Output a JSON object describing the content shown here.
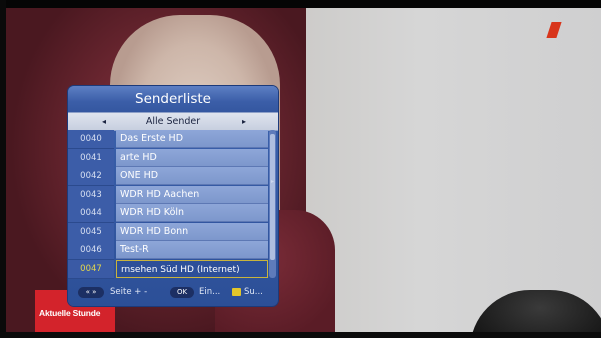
{
  "osd": {
    "title": "Senderliste",
    "filter": {
      "label": "Alle Sender",
      "left_arrow": "◂",
      "right_arrow": "▸"
    },
    "channels": [
      {
        "number": "0040",
        "name": "Das Erste HD"
      },
      {
        "number": "0041",
        "name": "arte HD"
      },
      {
        "number": "0042",
        "name": "ONE HD"
      },
      {
        "number": "0043",
        "name": "WDR HD Aachen"
      },
      {
        "number": "0044",
        "name": "WDR HD Köln"
      },
      {
        "number": "0045",
        "name": "WDR HD Bonn"
      },
      {
        "number": "0046",
        "name": "Test-R"
      },
      {
        "number": "0047",
        "name": "rnsehen Süd HD (Internet)"
      }
    ],
    "selected_channel": "0047",
    "footer": {
      "page_key": "« »",
      "page_text": "Seite + -",
      "ok_key": "OK",
      "ok_text": "Ein...",
      "yellow_key_text": "Su..."
    }
  },
  "overlay": {
    "news_badge": "Aktuelle Stunde"
  },
  "colors": {
    "osd_blue": "#2c4f97",
    "row_light": "#8ea6d8",
    "selection_border": "#c9b43d",
    "selected_number": "#e6d84a",
    "yellow_key": "#e2c62a",
    "badge_red": "#d3232b"
  }
}
